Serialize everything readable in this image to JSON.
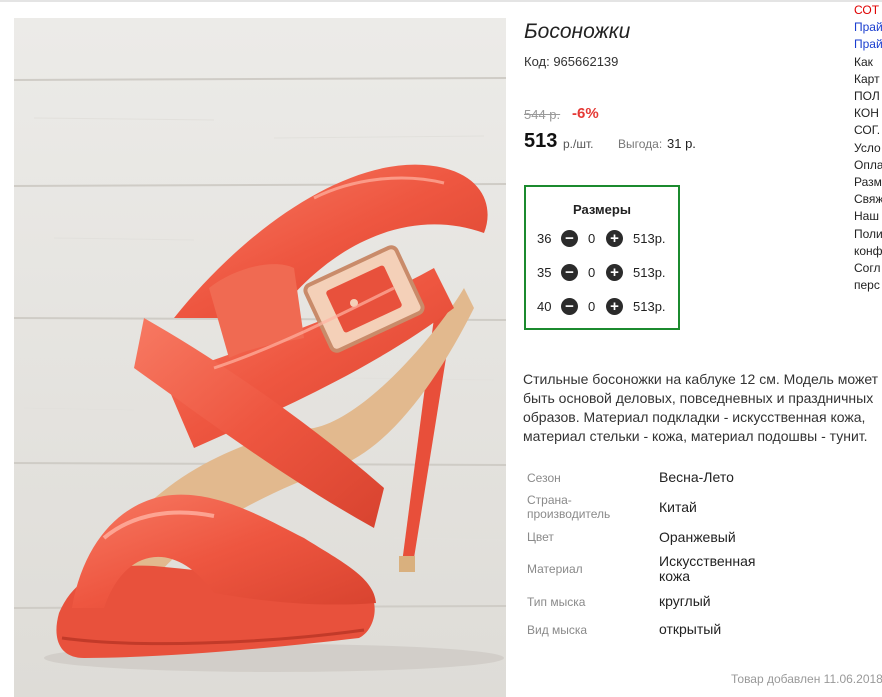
{
  "product": {
    "title": "Босоножки",
    "code": "Код: 965662139",
    "old_price": "544 р.",
    "discount": "-6%",
    "price": "513",
    "unit": "р./шт.",
    "benefit_label": "Выгода:",
    "benefit_value": "31 р."
  },
  "sizes": {
    "title": "Размеры",
    "rows": [
      {
        "size": "36",
        "qty": "0",
        "price": "513р."
      },
      {
        "size": "35",
        "qty": "0",
        "price": "513р."
      },
      {
        "size": "40",
        "qty": "0",
        "price": "513р."
      }
    ],
    "minus_icon": "−",
    "plus_icon": "+"
  },
  "description": "Стильные босоножки на каблуке 12 см. Модель может быть основой деловых, повседневных и праздничных образов. Материал подкладки - искусственная кожа, материал стельки - кожа, материал подошвы - тунит.",
  "attributes": [
    {
      "label": "Сезон",
      "value": "Весна-Лето"
    },
    {
      "label": "Страна-производитель",
      "value": "Китай"
    },
    {
      "label": "Цвет",
      "value": "Оранжевый"
    },
    {
      "label": "Материал",
      "value": "Искусственная кожа"
    },
    {
      "label": "Тип мыска",
      "value": "круглый"
    },
    {
      "label": "Вид мыска",
      "value": "открытый"
    }
  ],
  "added_date": "Товар добавлен 11.06.2018",
  "side_menu": [
    {
      "text": "СОТ",
      "color": "red"
    },
    {
      "text": "Прай",
      "color": "blue"
    },
    {
      "text": "Прай",
      "color": "blue"
    },
    {
      "text": "Как",
      "color": "dark"
    },
    {
      "text": "Карт",
      "color": "dark"
    },
    {
      "text": "ПОЛ",
      "color": "dark"
    },
    {
      "text": "КОН",
      "color": "dark"
    },
    {
      "text": "СОГ.",
      "color": "dark"
    },
    {
      "text": "Усло",
      "color": "dark"
    },
    {
      "text": "Опла",
      "color": "dark"
    },
    {
      "text": "Разм",
      "color": "dark"
    },
    {
      "text": "Свяж",
      "color": "dark"
    },
    {
      "text": "Наш",
      "color": "dark"
    },
    {
      "text": "Поли",
      "color": "dark"
    },
    {
      "text": "конф",
      "color": "dark"
    },
    {
      "text": "Согл",
      "color": "dark"
    },
    {
      "text": "перс",
      "color": "dark"
    }
  ],
  "colors": {
    "accent_green": "#1b8a2e",
    "discount_red": "#e53935",
    "shoe": "#ef5a45"
  }
}
